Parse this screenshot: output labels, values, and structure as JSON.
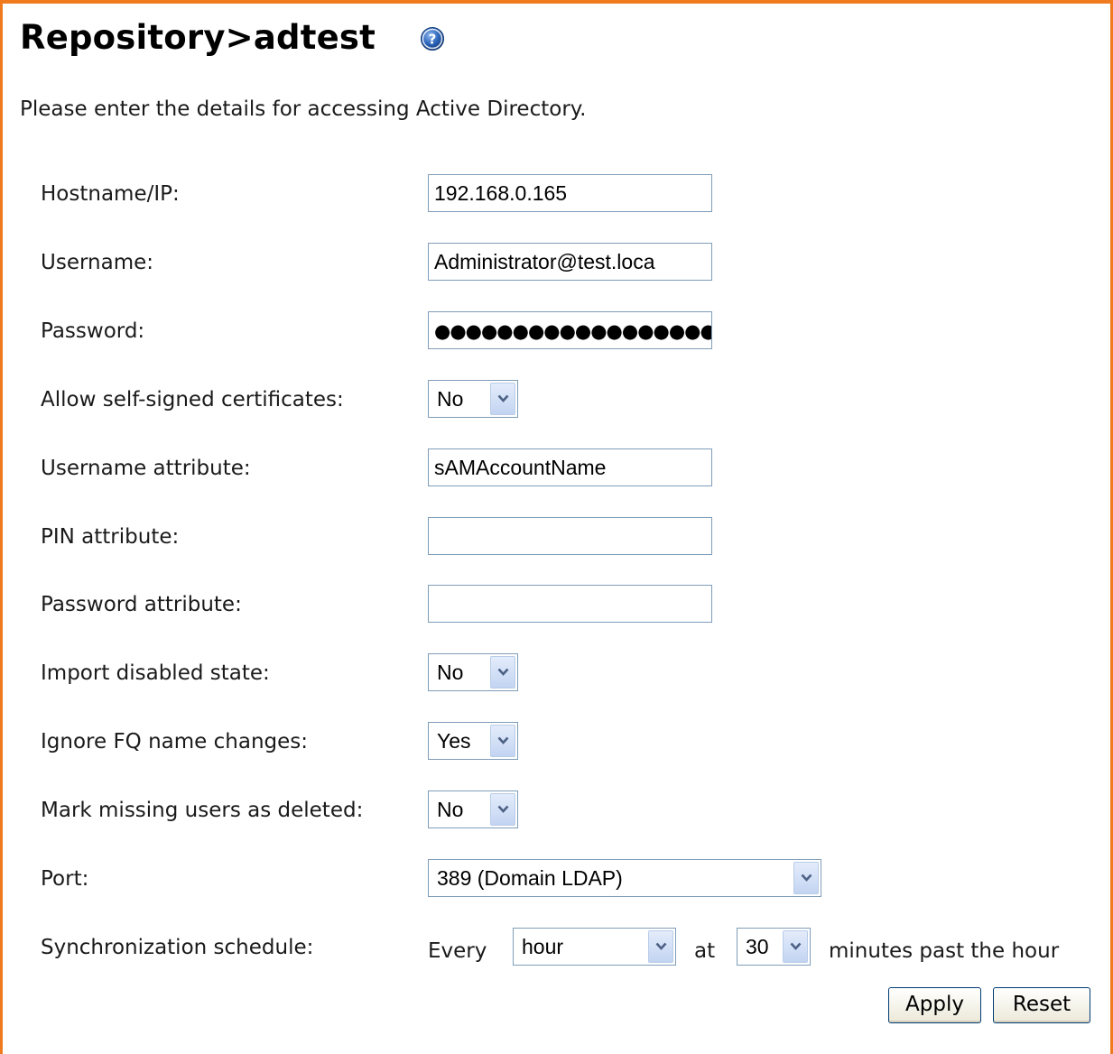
{
  "title": "Repository>adtest",
  "intro": "Please enter the details for accessing Active Directory.",
  "fields": {
    "hostname": {
      "label": "Hostname/IP:",
      "value": "192.168.0.165"
    },
    "username": {
      "label": "Username:",
      "value": "Administrator@test.loca"
    },
    "password": {
      "label": "Password:",
      "value": "●●●●●●●●●●●●●●●●●●●●"
    },
    "allow_self_signed": {
      "label": "Allow self-signed certificates:",
      "value": "No"
    },
    "username_attribute": {
      "label": "Username attribute:",
      "value": "sAMAccountName"
    },
    "pin_attribute": {
      "label": "PIN attribute:",
      "value": ""
    },
    "password_attribute": {
      "label": "Password attribute:",
      "value": ""
    },
    "import_disabled": {
      "label": "Import disabled state:",
      "value": "No"
    },
    "ignore_fq": {
      "label": "Ignore FQ name changes:",
      "value": "Yes"
    },
    "mark_missing": {
      "label": "Mark missing users as deleted:",
      "value": "No"
    },
    "port": {
      "label": "Port:",
      "value": "389 (Domain LDAP)"
    }
  },
  "schedule": {
    "label": "Synchronization schedule:",
    "every_text": "Every",
    "period": "hour",
    "at_text": "at",
    "minutes": "30",
    "suffix": "minutes past the hour"
  },
  "buttons": {
    "apply": "Apply",
    "reset": "Reset"
  },
  "colors": {
    "frame_border": "#f07a1e",
    "input_border": "#7f9db9",
    "help_icon": "#2a63b8"
  }
}
